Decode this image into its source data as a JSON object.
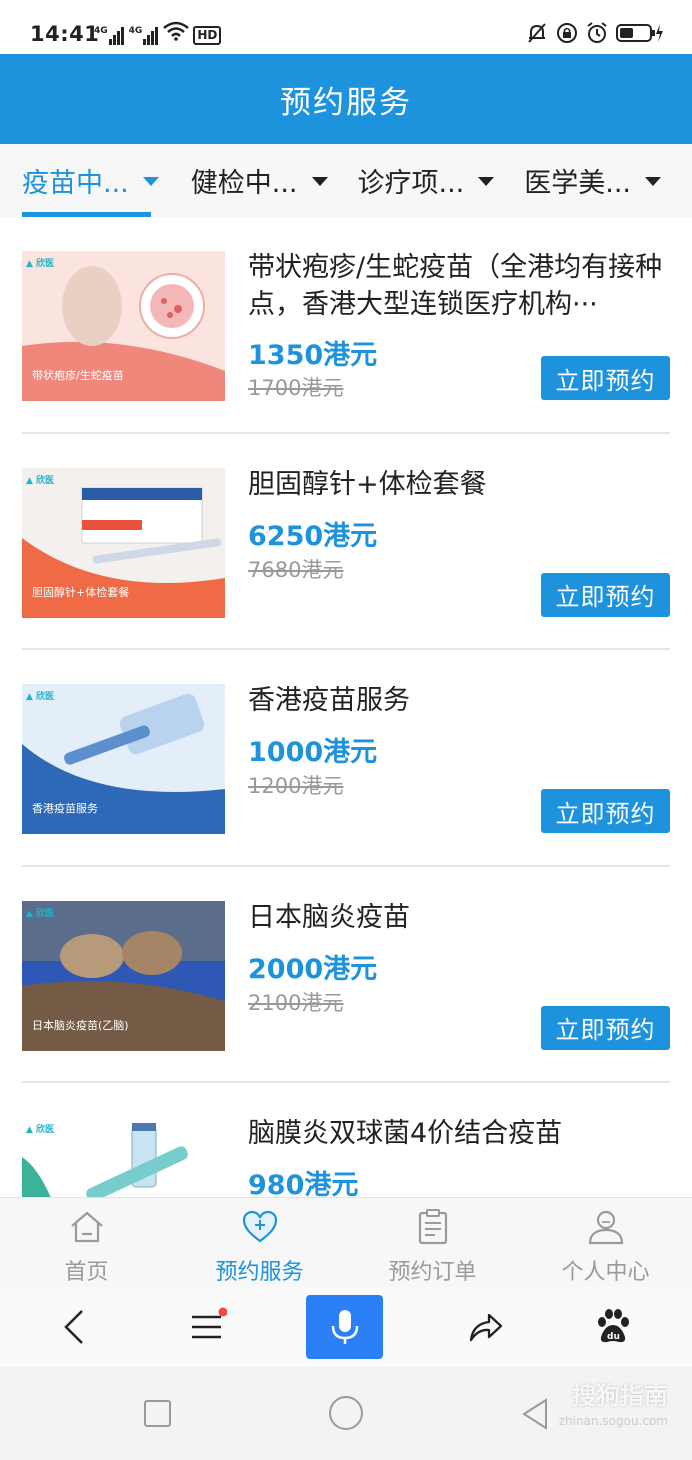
{
  "status_bar": {
    "time": "14:41",
    "network_1": "4G",
    "network_2": "4G",
    "hd_badge": "HD",
    "icons": [
      "mute-icon",
      "lock-rotation-icon",
      "alarm-icon",
      "battery-charging-icon"
    ]
  },
  "header": {
    "title": "预约服务"
  },
  "tabs": [
    {
      "label": "疫苗中...",
      "active": true
    },
    {
      "label": "健检中...",
      "active": false
    },
    {
      "label": "诊疗项...",
      "active": false
    },
    {
      "label": "医学美...",
      "active": false
    }
  ],
  "products": [
    {
      "name": "带状疱疹/生蛇疫苗（全港均有接种点，香港大型连锁医疗机构···",
      "price": "1350港元",
      "original_price": "1700港元",
      "button": "立即预约",
      "thumb_label": "带状疱疹/生蛇疫苗"
    },
    {
      "name": "胆固醇针+体检套餐",
      "price": "6250港元",
      "original_price": "7680港元",
      "button": "立即预约",
      "thumb_label": "胆固醇针+体检套餐"
    },
    {
      "name": "香港疫苗服务",
      "price": "1000港元",
      "original_price": "1200港元",
      "button": "立即预约",
      "thumb_label": "香港疫苗服务"
    },
    {
      "name": "日本脑炎疫苗",
      "price": "2000港元",
      "original_price": "2100港元",
      "button": "立即预约",
      "thumb_label": "日本脑炎疫苗(乙脑)"
    },
    {
      "name": "脑膜炎双球菌4价结合疫苗",
      "price": "980港元",
      "original_price": "",
      "button": "",
      "thumb_label": ""
    }
  ],
  "bottom_nav": [
    {
      "label": "首页",
      "icon": "home-icon",
      "active": false
    },
    {
      "label": "预约服务",
      "icon": "heart-plus-icon",
      "active": true
    },
    {
      "label": "预约订单",
      "icon": "clipboard-icon",
      "active": false
    },
    {
      "label": "个人中心",
      "icon": "user-icon",
      "active": false
    }
  ],
  "browser_bar": {
    "icons": [
      "back-icon",
      "menu-icon",
      "microphone-icon",
      "share-icon",
      "baidu-paw-icon"
    ]
  },
  "watermark": {
    "text": "搜狗指南",
    "sub": "zhinan.sogou.com"
  },
  "colors": {
    "primary": "#1d92dd",
    "mic": "#2b7ff7",
    "notification_dot": "#f04848"
  }
}
